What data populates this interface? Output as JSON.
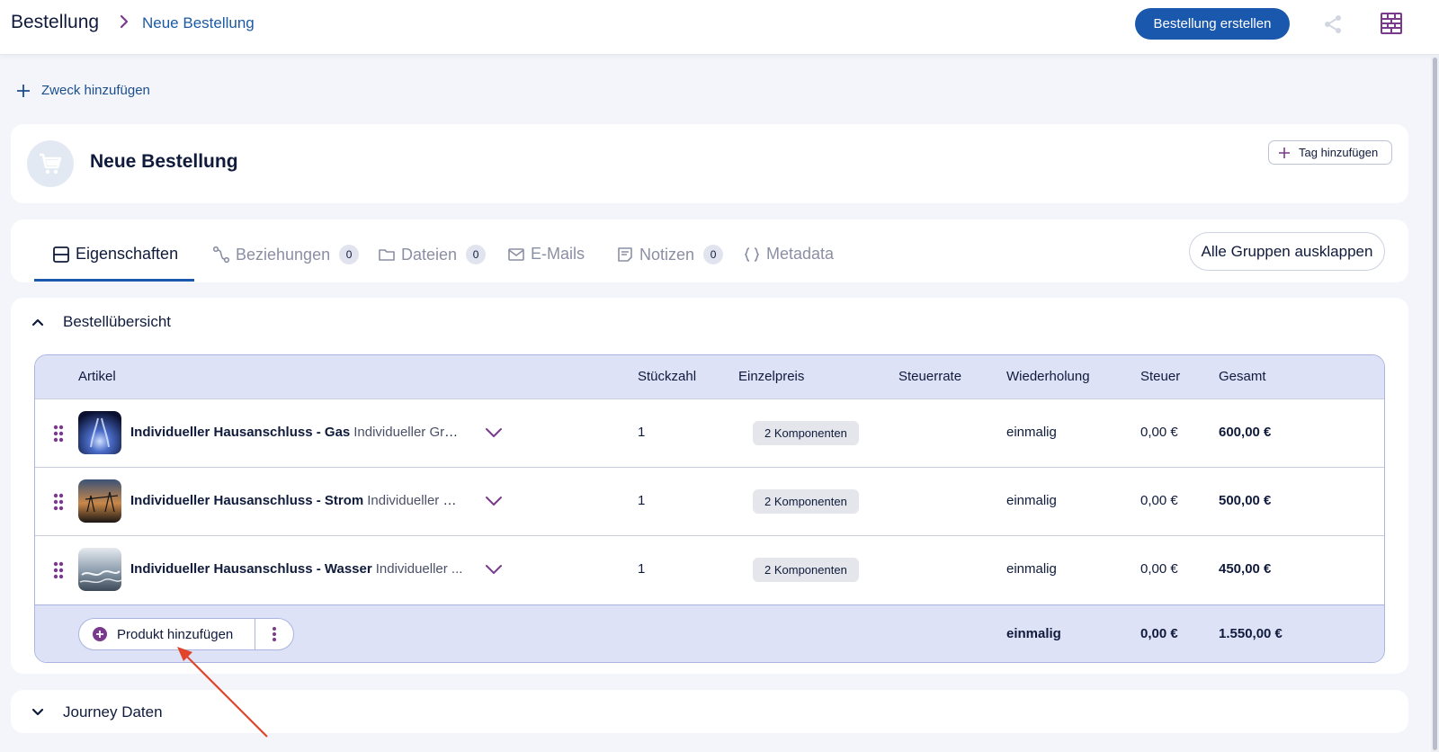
{
  "breadcrumb": {
    "root": "Bestellung",
    "current": "Neue Bestellung"
  },
  "header": {
    "create_button": "Bestellung erstellen",
    "share_icon": "share-icon",
    "layout_icon": "layout-grid-icon"
  },
  "purpose": {
    "add_label": "Zweck hinzufügen"
  },
  "entity": {
    "title": "Neue Bestellung",
    "icon": "shopping-cart-icon",
    "tag_button": "Tag hinzufügen"
  },
  "tabs": [
    {
      "label": "Eigenschaften",
      "icon": "properties-icon",
      "count": null,
      "active": true
    },
    {
      "label": "Beziehungen",
      "icon": "relations-icon",
      "count": "0",
      "active": false
    },
    {
      "label": "Dateien",
      "icon": "folder-icon",
      "count": "0",
      "active": false
    },
    {
      "label": "E-Mails",
      "icon": "mail-icon",
      "count": null,
      "active": false
    },
    {
      "label": "Notizen",
      "icon": "notes-icon",
      "count": "0",
      "active": false
    },
    {
      "label": "Metadata",
      "icon": "braces-icon",
      "count": null,
      "active": false
    }
  ],
  "expand_all_button": "Alle Gruppen ausklappen",
  "order_section": {
    "title": "Bestellübersicht",
    "columns": [
      "Artikel",
      "Stückzahl",
      "Einzelpreis",
      "Steuerrate",
      "Wiederholung",
      "Steuer",
      "Gesamt"
    ],
    "rows": [
      {
        "name": "Individueller Hausanschluss - Gas",
        "desc": "Individueller Grun...",
        "qty": "1",
        "unit_price": "2 Komponenten",
        "tax_rate": "",
        "recurrence": "einmalig",
        "tax": "0,00 €",
        "total": "600,00 €"
      },
      {
        "name": "Individueller Hausanschluss - Strom",
        "desc": "Individueller Gr...",
        "qty": "1",
        "unit_price": "2 Komponenten",
        "tax_rate": "",
        "recurrence": "einmalig",
        "tax": "0,00 €",
        "total": "500,00 €"
      },
      {
        "name": "Individueller Hausanschluss - Wasser",
        "desc": "Individueller ...",
        "qty": "1",
        "unit_price": "2 Komponenten",
        "tax_rate": "",
        "recurrence": "einmalig",
        "tax": "0,00 €",
        "total": "450,00 €"
      }
    ],
    "footer": {
      "add_product": "Produkt hinzufügen",
      "recurrence": "einmalig",
      "tax": "0,00 €",
      "total": "1.550,00 €"
    }
  },
  "journey_section": {
    "title": "Journey Daten"
  },
  "colors": {
    "primary": "#1a58ad",
    "accent_purple": "#7a3a8c",
    "table_header": "#dde2f7",
    "annotation_arrow": "#e0442a"
  }
}
